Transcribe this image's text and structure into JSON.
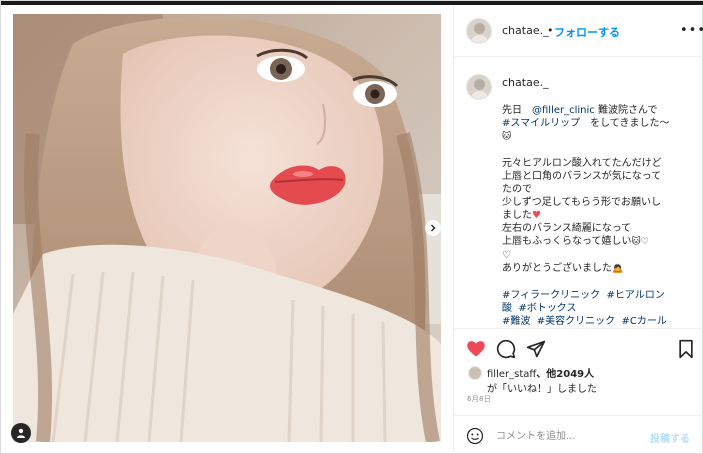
{
  "post": {
    "username": "chatae._",
    "follow_separator": "•",
    "follow_label": "フォローする",
    "more_label": "•••",
    "caption_lines": [
      {
        "parts": [
          {
            "t": "先日　",
            "k": "text"
          },
          {
            "t": "@filler_clinic",
            "k": "mention"
          },
          {
            "t": " 難波院さんで",
            "k": "text"
          }
        ]
      },
      {
        "parts": [
          {
            "t": "#スマイルリップ",
            "k": "tag"
          },
          {
            "t": "　をしてきました〜",
            "k": "text"
          }
        ]
      },
      {
        "parts": [
          {
            "t": "🐱",
            "k": "emoji"
          }
        ]
      },
      {
        "parts": [
          {
            "t": " ",
            "k": "text"
          }
        ]
      },
      {
        "parts": [
          {
            "t": "元々ヒアルロン酸入れてたんだけど",
            "k": "text"
          }
        ]
      },
      {
        "parts": [
          {
            "t": "上唇と口角のバランスが気になって",
            "k": "text"
          }
        ]
      },
      {
        "parts": [
          {
            "t": "たので",
            "k": "text"
          }
        ]
      },
      {
        "parts": [
          {
            "t": "少しずつ足してもらう形でお願いし",
            "k": "text"
          }
        ]
      },
      {
        "parts": [
          {
            "t": "ました",
            "k": "text"
          },
          {
            "t": "♥",
            "k": "heart"
          }
        ]
      },
      {
        "parts": [
          {
            "t": "左右のバランス綺麗になって",
            "k": "text"
          }
        ]
      },
      {
        "parts": [
          {
            "t": "上唇もふっくらなって嬉しい",
            "k": "text"
          },
          {
            "t": "🐱♡",
            "k": "emoji"
          }
        ]
      },
      {
        "parts": [
          {
            "t": "♡",
            "k": "text"
          }
        ]
      },
      {
        "parts": [
          {
            "t": "ありがとうございました",
            "k": "text"
          },
          {
            "t": "🙇",
            "k": "emoji"
          }
        ]
      },
      {
        "parts": [
          {
            "t": " ",
            "k": "text"
          }
        ]
      },
      {
        "parts": [
          {
            "t": "#フィラークリニック",
            "k": "tag"
          },
          {
            "t": "  ",
            "k": "text"
          },
          {
            "t": "#ヒアルロン",
            "k": "tag"
          }
        ]
      },
      {
        "parts": [
          {
            "t": "酸",
            "k": "tag"
          },
          {
            "t": "  ",
            "k": "text"
          },
          {
            "t": "#ボトックス",
            "k": "tag"
          }
        ]
      },
      {
        "parts": [
          {
            "t": "#難波",
            "k": "tag"
          },
          {
            "t": "  ",
            "k": "text"
          },
          {
            "t": "#美容クリニック",
            "k": "tag"
          },
          {
            "t": "  ",
            "k": "text"
          },
          {
            "t": "#Cカール",
            "k": "tag"
          }
        ]
      }
    ],
    "likes": {
      "first_liker": "filler_staff",
      "others_text": "、他2049人",
      "suffix_text": "が「いいね！」しました"
    },
    "date": "6月8日",
    "comment": {
      "placeholder": "コメントを追加...",
      "post_label": "投稿する"
    }
  },
  "colors": {
    "accent": "#0095f6",
    "like_red": "#ed4956",
    "hashtag": "#00376b"
  },
  "icons": {
    "like": "heart-icon",
    "comment": "comment-icon",
    "share": "share-icon",
    "save": "bookmark-icon",
    "emoji": "smile-icon",
    "carousel": "chevron-right-icon",
    "tag": "user-tag-icon"
  }
}
